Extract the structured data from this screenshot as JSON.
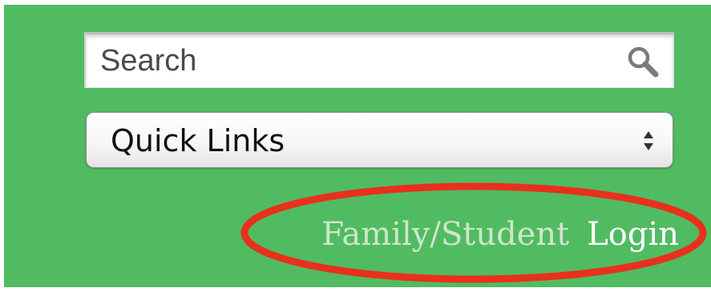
{
  "search": {
    "placeholder": "Search",
    "icon": "search-icon"
  },
  "quick_links": {
    "selected": "Quick Links",
    "icon": "updown-arrows-icon"
  },
  "login": {
    "family_student_label": "Family/Student",
    "login_label": "Login"
  },
  "colors": {
    "background": "#51bb62",
    "annotation": "#e8301c",
    "family_student_text": "#cfe6c9",
    "login_text": "#ffffff"
  }
}
